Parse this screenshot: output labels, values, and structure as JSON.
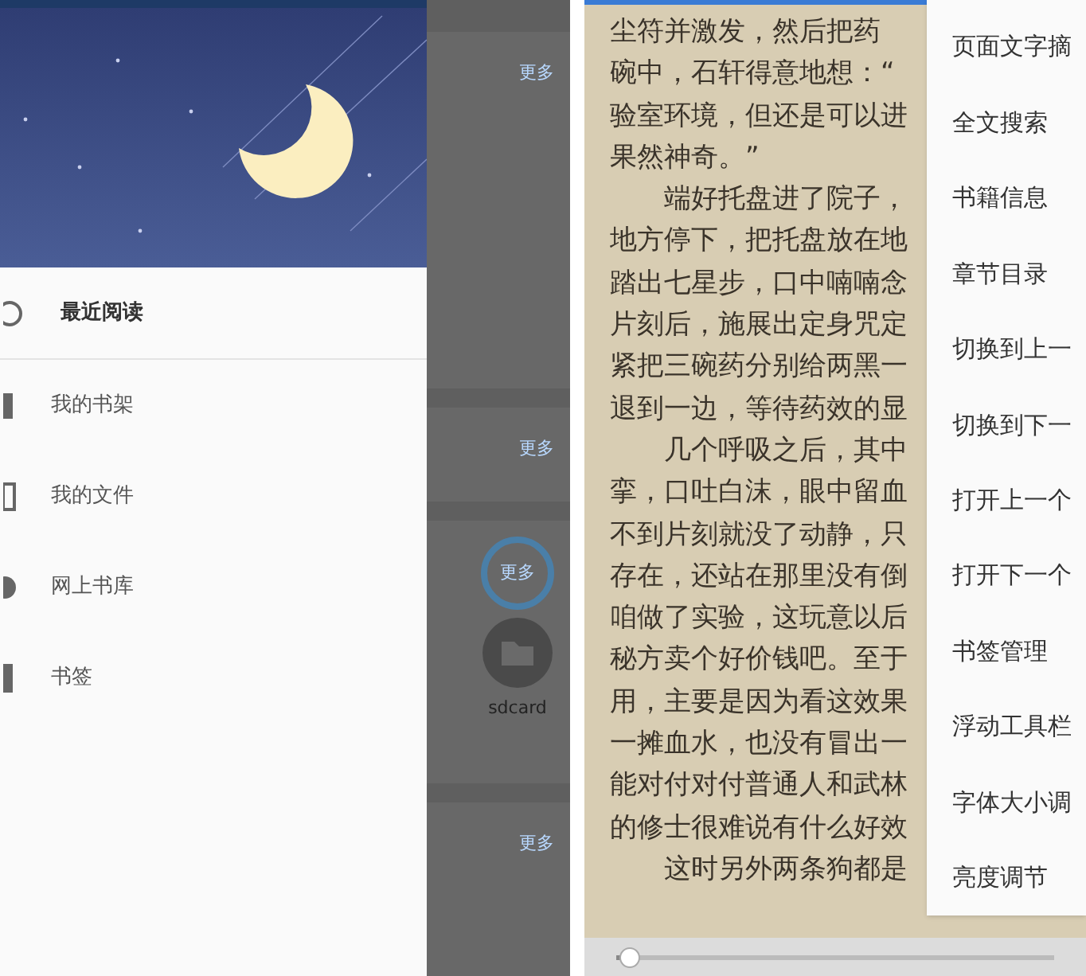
{
  "drawer": {
    "items": [
      {
        "label": "最近阅读",
        "selected": true
      },
      {
        "label": "我的书架",
        "selected": false
      },
      {
        "label": "我的文件",
        "selected": false
      },
      {
        "label": "网上书库",
        "selected": false
      },
      {
        "label": "书签",
        "selected": false
      }
    ]
  },
  "background": {
    "sections": [
      {
        "more": "更多"
      },
      {
        "more": "更多"
      },
      {
        "more": "更多",
        "folder": "sdcard"
      },
      {
        "more": "更多"
      }
    ]
  },
  "reader": {
    "lines": [
      {
        "text": "尘符并激发，然后把药",
        "indent": false
      },
      {
        "text": "碗中，石轩得意地想：“",
        "indent": false
      },
      {
        "text": "验室环境，但还是可以进",
        "indent": false
      },
      {
        "text": "果然神奇。”",
        "indent": false
      },
      {
        "text": "端好托盘进了院子，",
        "indent": true
      },
      {
        "text": "地方停下，把托盘放在地",
        "indent": false
      },
      {
        "text": "踏出七星步，口中喃喃念",
        "indent": false
      },
      {
        "text": "片刻后，施展出定身咒定",
        "indent": false
      },
      {
        "text": "紧把三碗药分别给两黑一",
        "indent": false
      },
      {
        "text": "退到一边，等待药效的显",
        "indent": false
      },
      {
        "text": "几个呼吸之后，其中",
        "indent": true
      },
      {
        "text": "挛，口吐白沫，眼中留血",
        "indent": false
      },
      {
        "text": "不到片刻就没了动静，只",
        "indent": false
      },
      {
        "text": "存在，还站在那里没有倒",
        "indent": false
      },
      {
        "text": "咱做了实验，这玩意以后",
        "indent": false
      },
      {
        "text": "秘方卖个好价钱吧。至于",
        "indent": false
      },
      {
        "text": "用，主要是因为看这效果",
        "indent": false
      },
      {
        "text": "一摊血水，也没有冒出一",
        "indent": false
      },
      {
        "text": "能对付对付普通人和武林",
        "indent": false
      },
      {
        "text": "的修士很难说有什么好效",
        "indent": false
      },
      {
        "text": "这时另外两条狗都是",
        "indent": true
      }
    ],
    "menu": [
      "页面文字摘",
      "全文搜索",
      "书籍信息",
      "章节目录",
      "切换到上一",
      "切换到下一",
      "打开上一个",
      "打开下一个",
      "书签管理",
      "浮动工具栏",
      "字体大小调",
      "亮度调节"
    ],
    "progress": {
      "level": 0.03
    }
  }
}
